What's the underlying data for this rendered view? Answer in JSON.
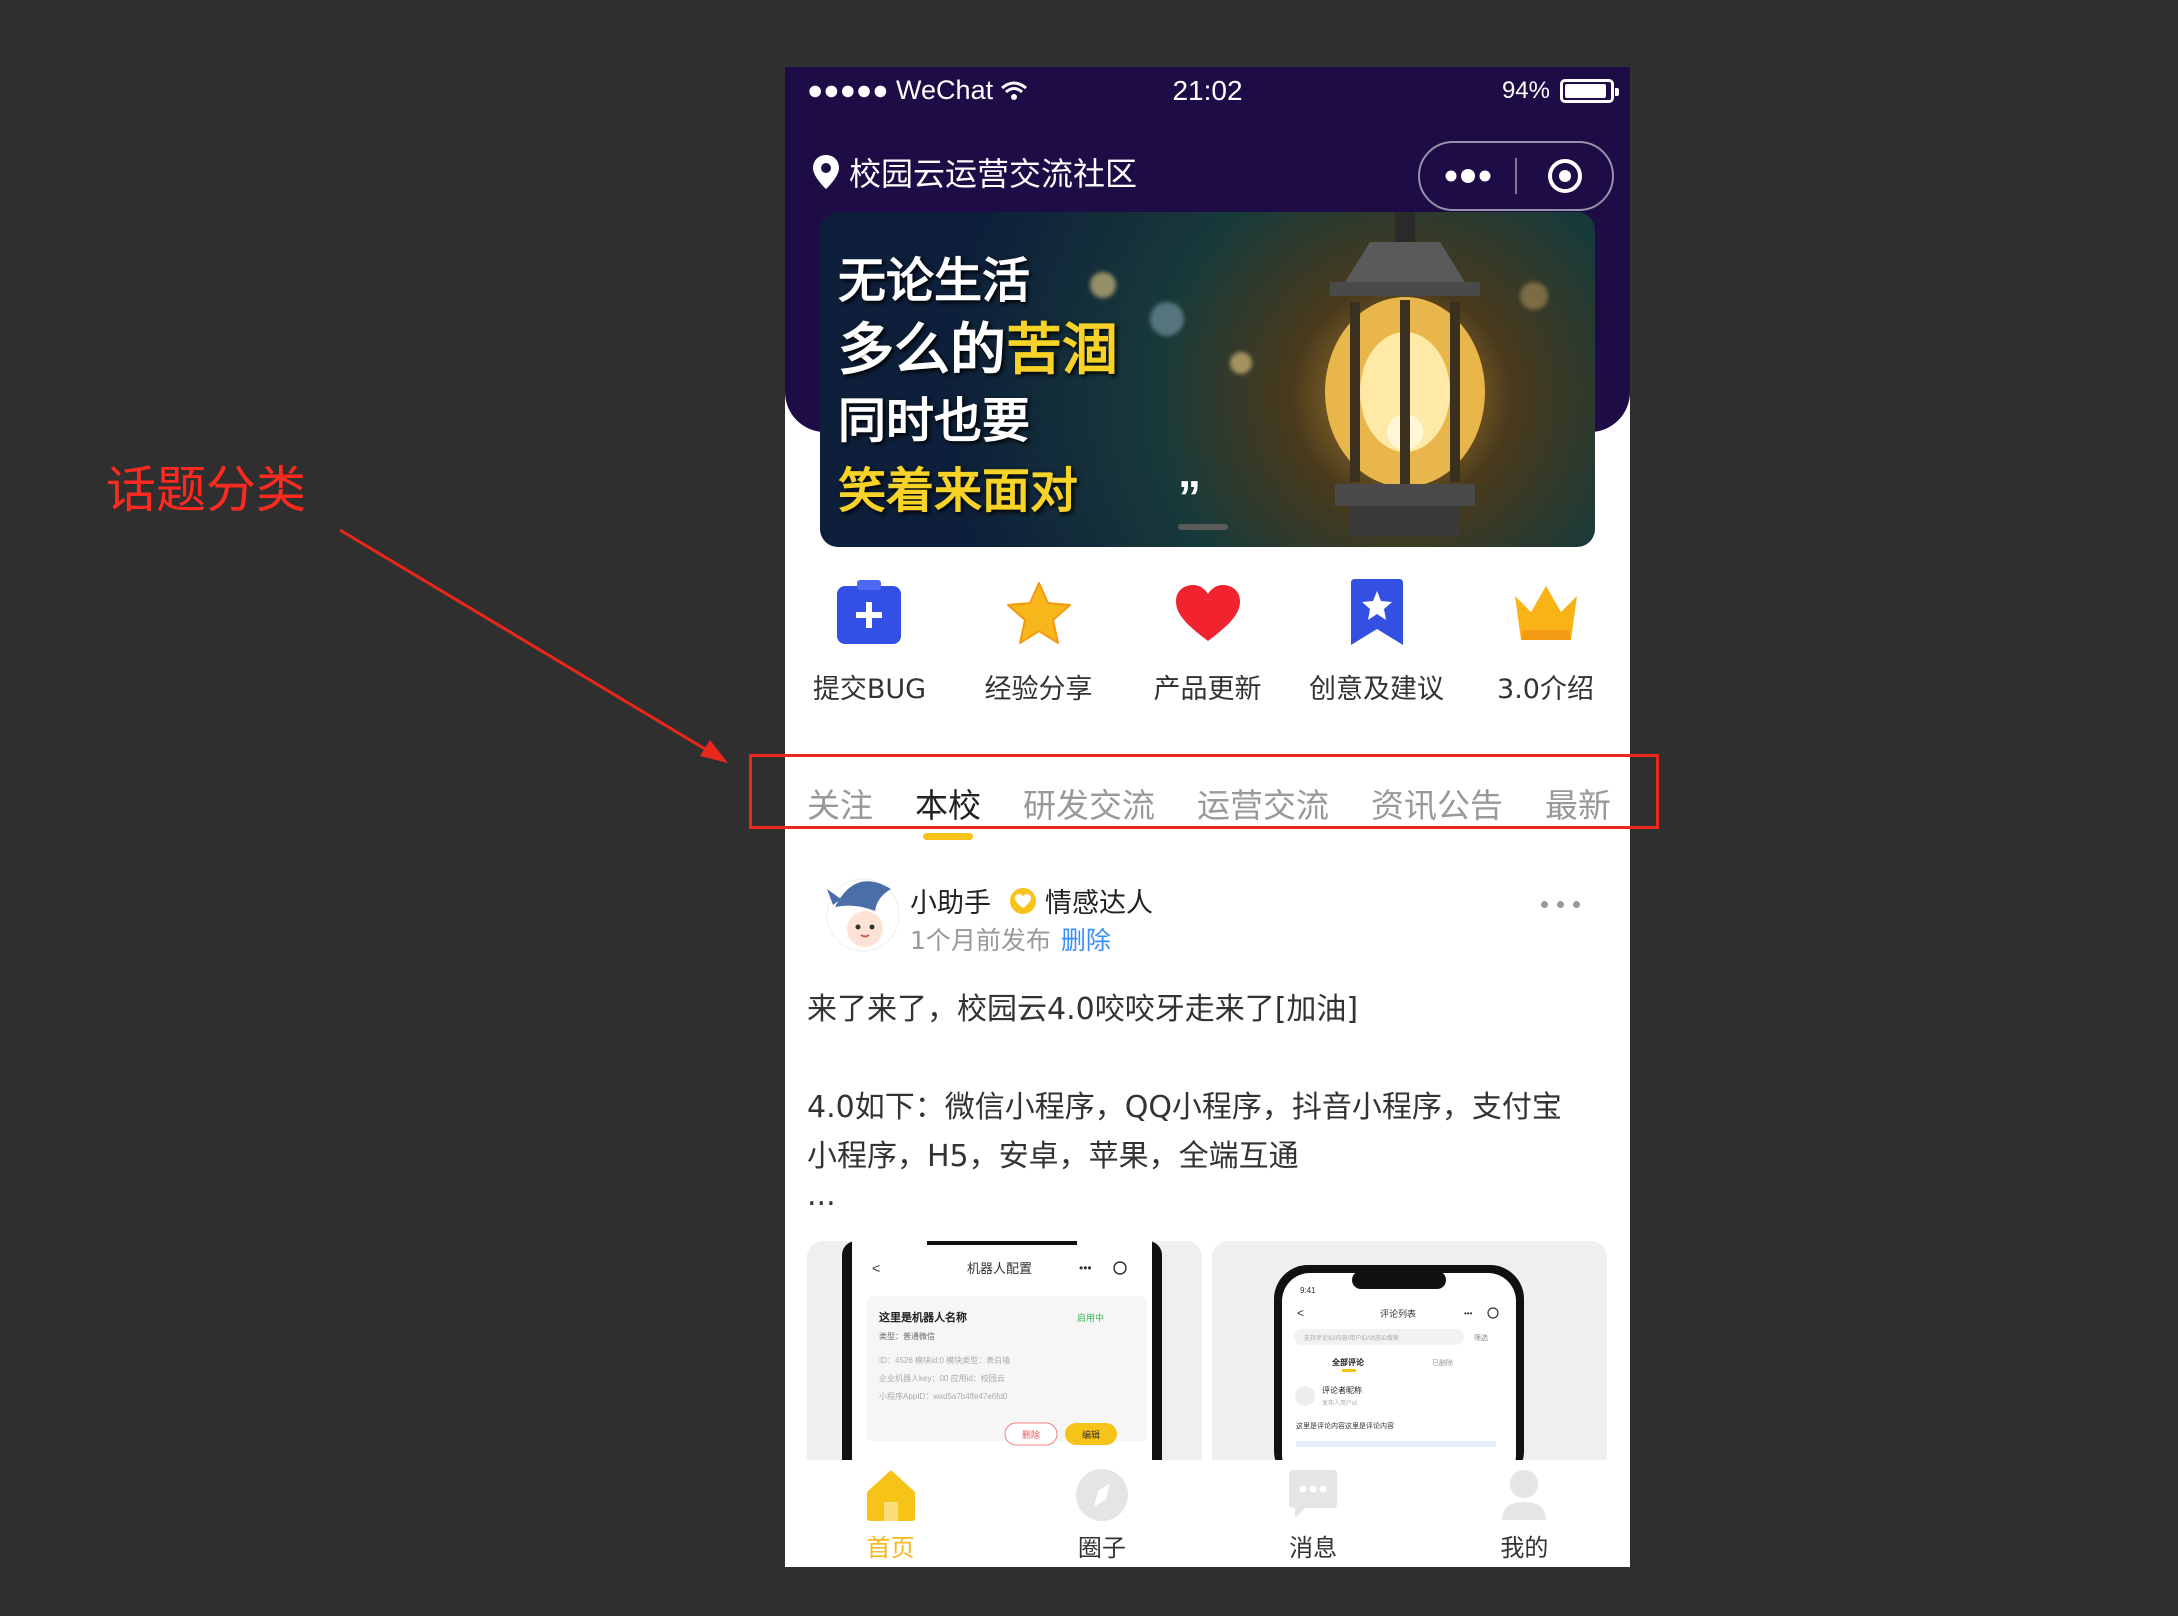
{
  "annotation": {
    "label": "话题分类"
  },
  "status_bar": {
    "carrier": "●●●●● WeChat",
    "time": "21:02",
    "battery": "94%"
  },
  "navbar": {
    "title": "校园云运营交流社区"
  },
  "banner": {
    "line1": "无论生活",
    "line2_a": "多么的",
    "line2_b": "苦涸",
    "line3": "同时也要",
    "line4": "笑着来面对",
    "quote": "”"
  },
  "categories": [
    {
      "label": "提交BUG",
      "icon": "add-box-icon"
    },
    {
      "label": "经验分享",
      "icon": "star-icon"
    },
    {
      "label": "产品更新",
      "icon": "heart-icon"
    },
    {
      "label": "创意及建议",
      "icon": "bookmark-star-icon"
    },
    {
      "label": "3.0介绍",
      "icon": "crown-icon"
    }
  ],
  "topic_tabs": [
    "关注",
    "本校",
    "研发交流",
    "运营交流",
    "资讯公告",
    "最新"
  ],
  "active_tab": "本校",
  "post": {
    "author": "小助手",
    "badge": "情感达人",
    "time": "1个月前发布",
    "delete_label": "删除",
    "line1": "来了来了，校园云4.0咬咬牙走来了[加油]",
    "line2": "4.0如下：微信小程序，QQ小程序，抖音小程序，支付宝",
    "line3": "小程序，H5，安卓，苹果，全端互通",
    "line4": "...",
    "shot1": {
      "title": "机器人配置",
      "name": "这里是机器人名称",
      "status": "启用中",
      "type": "类型：普通微信",
      "ids": "ID：4526    模块id:0    模块类型：表白墙",
      "key": "企业机器人key：00    应用id：校园云",
      "appid": "小程序AppID：wxd5a7b4ffe47e6fd0",
      "delete": "删除",
      "edit": "编辑"
    },
    "shot2": {
      "time": "9:41",
      "title": "评论列表",
      "search": "支持评论ID/内容/用户ID/动态ID搜索",
      "filter": "筛选",
      "tab_all": "全部评论",
      "tab_deleted": "已删除",
      "nick": "评论者昵称",
      "sub": "发布人用户id",
      "content": "这里是评论内容这里是评论内容"
    }
  },
  "tabbar": [
    {
      "label": "首页",
      "icon": "home-icon"
    },
    {
      "label": "圈子",
      "icon": "compass-icon"
    },
    {
      "label": "消息",
      "icon": "message-icon"
    },
    {
      "label": "我的",
      "icon": "user-icon"
    }
  ],
  "colors": {
    "header_bg": "#1d0c45",
    "accent": "#f6c318",
    "annotation": "#e8271d",
    "link": "#3a8ef5"
  }
}
